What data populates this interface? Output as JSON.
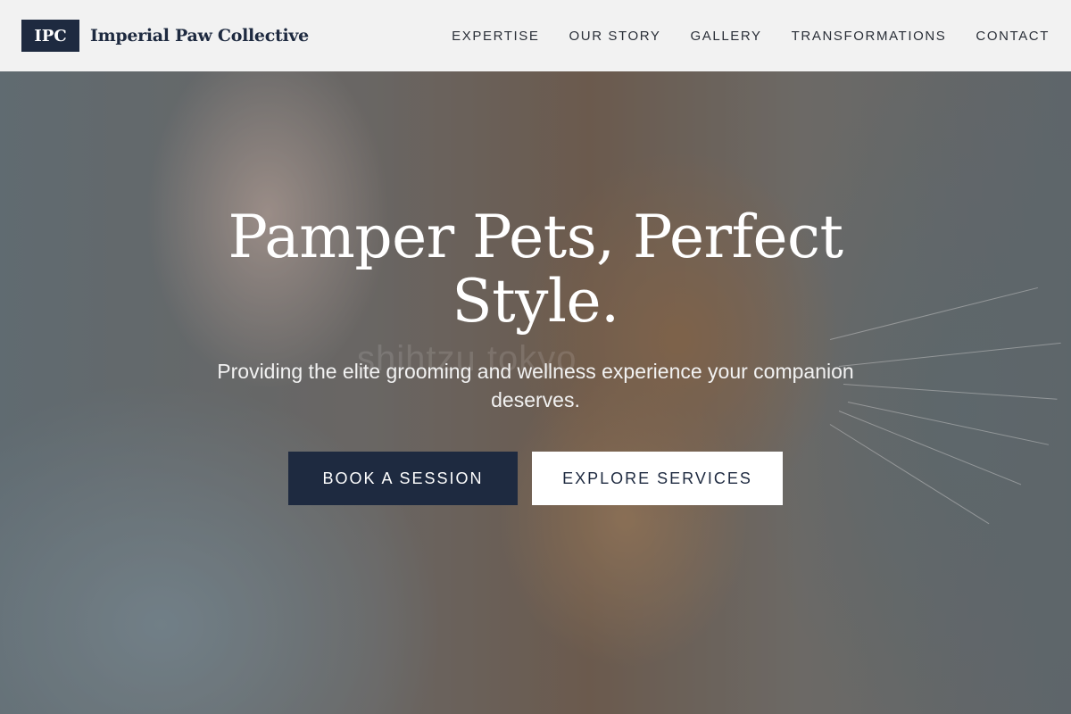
{
  "brand": {
    "logo_text": "IPC",
    "name": "Imperial Paw Collective"
  },
  "nav": {
    "items": [
      {
        "label": "EXPERTISE"
      },
      {
        "label": "OUR STORY"
      },
      {
        "label": "GALLERY"
      },
      {
        "label": "TRANSFORMATIONS"
      },
      {
        "label": "CONTACT"
      }
    ]
  },
  "hero": {
    "title": "Pamper Pets, Perfect Style.",
    "subtitle": "Providing the elite grooming and wellness experience your companion deserves.",
    "primary_button": "BOOK A SESSION",
    "secondary_button": "EXPLORE SERVICES",
    "image_watermark": "shihtzu tokyo"
  },
  "colors": {
    "brand_navy": "#1e2a40",
    "header_bg": "#f2f2f2",
    "white": "#ffffff"
  }
}
